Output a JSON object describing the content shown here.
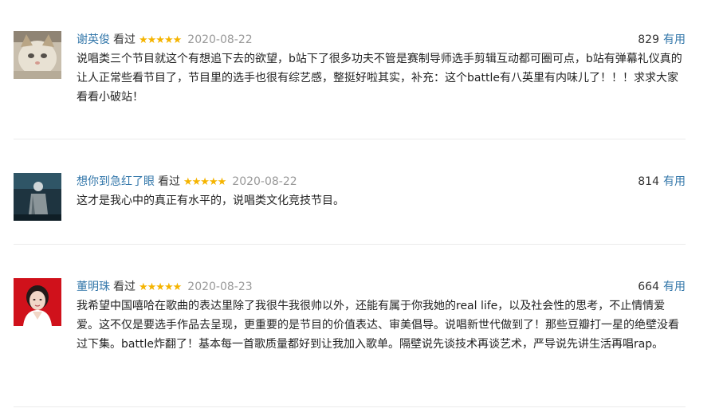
{
  "reviews": [
    {
      "author": "谢英俊",
      "status": "看过",
      "rating_stars": 5,
      "stars_text": "★★★★★",
      "date": "2020-08-22",
      "votes": "829",
      "vote_label": "有用",
      "avatar_icon": "kitten-photo",
      "content": "说唱类三个节目就这个有想追下去的欲望，b站下了很多功夫不管是赛制导师选手剪辑互动都可圈可点，b站有弹幕礼仪真的让人正常些看节目了，节目里的选手也很有综艺感，整挺好啦其实，补充：这个battle有八英里有内味儿了！！！求求大家看看小破站！"
    },
    {
      "author": "想你到急红了眼",
      "status": "看过",
      "rating_stars": 5,
      "stars_text": "★★★★★",
      "date": "2020-08-22",
      "votes": "814",
      "vote_label": "有用",
      "avatar_icon": "stage-performer-photo",
      "content": "这才是我心中的真正有水平的，说唱类文化竞技节目。"
    },
    {
      "author": "董明珠",
      "status": "看过",
      "rating_stars": 5,
      "stars_text": "★★★★★",
      "date": "2020-08-23",
      "votes": "664",
      "vote_label": "有用",
      "avatar_icon": "woman-portrait-red-background",
      "content": "我希望中国嘻哈在歌曲的表达里除了我很牛我很帅以外，还能有属于你我她的real life，以及社会性的思考，不止情情爱爱。这不仅是要选手作品去呈现，更重要的是节目的价值表达、审美倡导。说唱新世代做到了！那些豆瓣打一星的绝壁没看过下集。battle炸翻了！基本每一首歌质量都好到让我加入歌单。隔壁说先谈技术再谈艺术，严导说先讲生活再唱rap。"
    }
  ],
  "colors": {
    "link": "#3377aa",
    "star": "#f5b400",
    "date": "#999999",
    "divider": "#ebebeb"
  }
}
